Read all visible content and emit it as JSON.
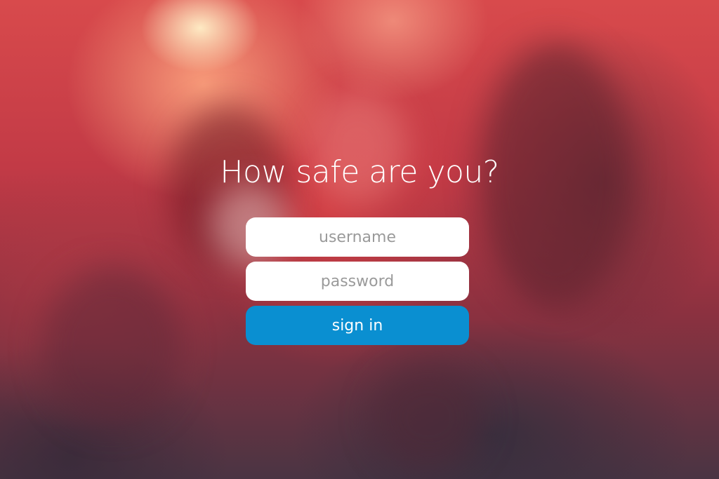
{
  "login": {
    "headline": "How safe are you?",
    "username_placeholder": "username",
    "password_placeholder": "password",
    "signin_label": "sign in"
  },
  "colors": {
    "button_background": "#0a8fd1",
    "field_background": "#ffffff",
    "headline_color": "#ffffff"
  }
}
